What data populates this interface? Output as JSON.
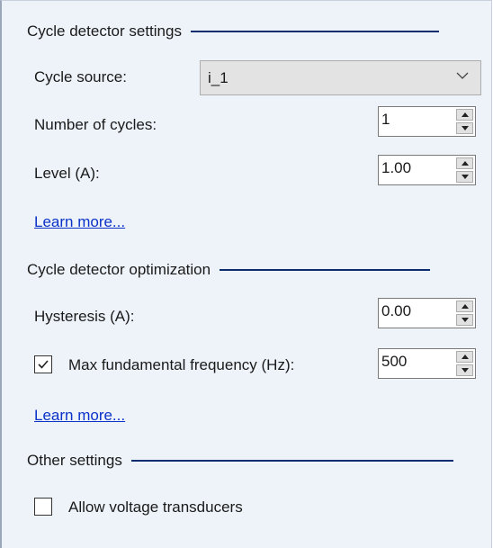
{
  "colors": {
    "panel_background": "#eef3fa",
    "section_rule": "#0b2c6e",
    "link": "#0a32c8",
    "combo_background": "#e3e3e3"
  },
  "cycle_detector_settings": {
    "title": "Cycle detector settings",
    "cycle_source": {
      "label": "Cycle source:",
      "value": "i_1"
    },
    "number_of_cycles": {
      "label": "Number of cycles:",
      "value": "1"
    },
    "level": {
      "label": "Level (A):",
      "value": "1.00"
    },
    "learn_more": "Learn more..."
  },
  "cycle_detector_optimization": {
    "title": "Cycle detector optimization",
    "hysteresis": {
      "label": "Hysteresis (A):",
      "value": "0.00"
    },
    "max_fundamental_frequency": {
      "label": "Max fundamental frequency (Hz):",
      "value": "500",
      "checked": true
    },
    "learn_more": "Learn more..."
  },
  "other_settings": {
    "title": "Other settings",
    "allow_voltage_transducers": {
      "label": "Allow voltage transducers",
      "checked": false
    }
  }
}
